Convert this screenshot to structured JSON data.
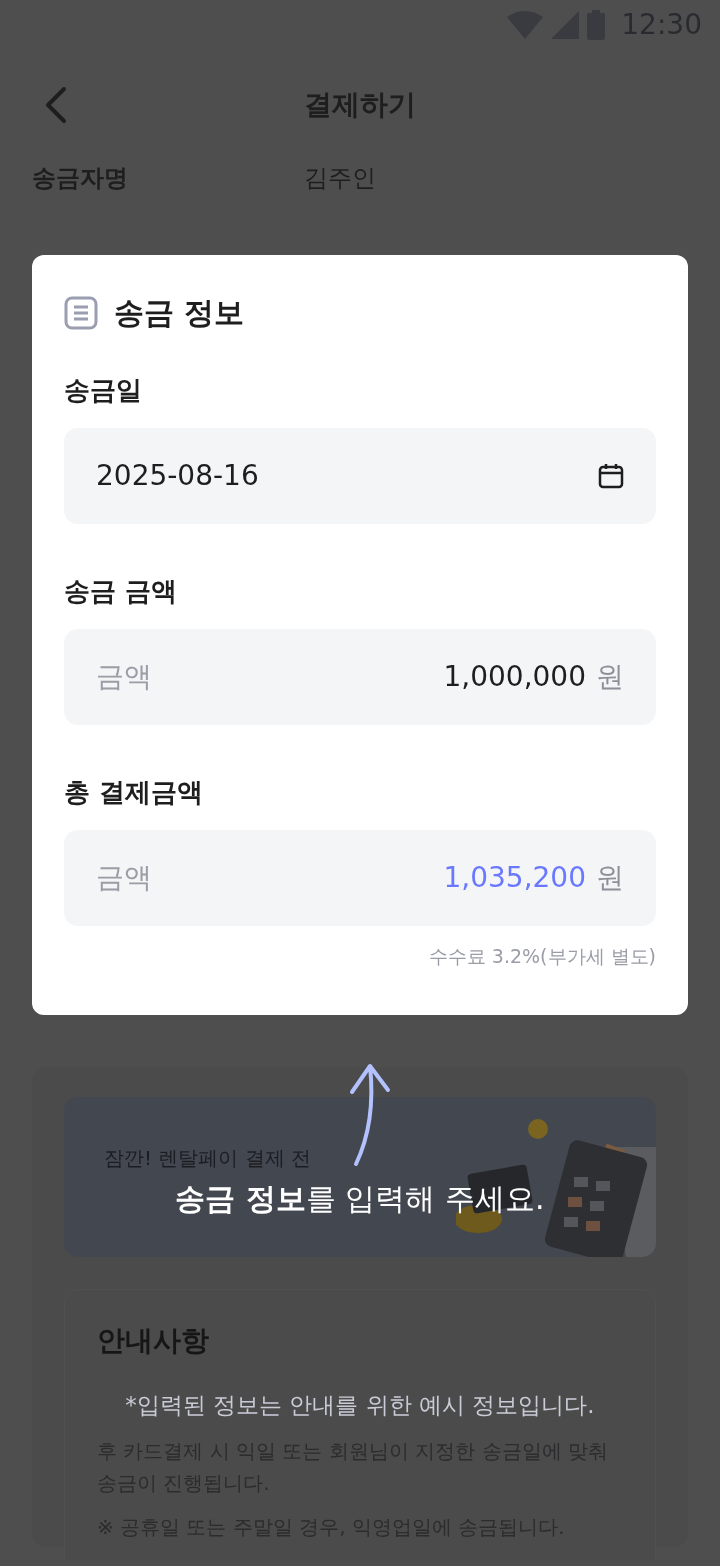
{
  "status_bar": {
    "time": "12:30"
  },
  "header": {
    "title": "결제하기"
  },
  "sender": {
    "label": "송금자명",
    "value": "김주인"
  },
  "popup": {
    "title": "송금 정보",
    "fields": [
      {
        "kind": "date",
        "label": "송금일",
        "value": "2025-08-16"
      },
      {
        "kind": "amount",
        "label": "송금 금액",
        "prefix": "금액",
        "value": "1,000,000",
        "unit": "원",
        "emphasized": false
      },
      {
        "kind": "amount",
        "label": "총 결제금액",
        "prefix": "금액",
        "value": "1,035,200",
        "unit": "원",
        "emphasized": true
      }
    ],
    "note": "수수료 3.2%(부가세 별도)"
  },
  "banner": {
    "eyebrow": "잠깐!  렌탈페이 결제 전"
  },
  "guide": {
    "title": "안내사항",
    "paragraphs": [
      "후 카드결제 시 익일 또는 회원님이 지정한 송금일에 맞춰 송금이 진행됩니다.",
      "※ 공휴일 또는 주말일 경우, 익영업일에 송금됩니다."
    ]
  },
  "coach": {
    "message": "**송금 정보**를 입력해 주세요.",
    "disclaimer": "*입력된 정보는 안내를 위한 예시 정보입니다."
  }
}
